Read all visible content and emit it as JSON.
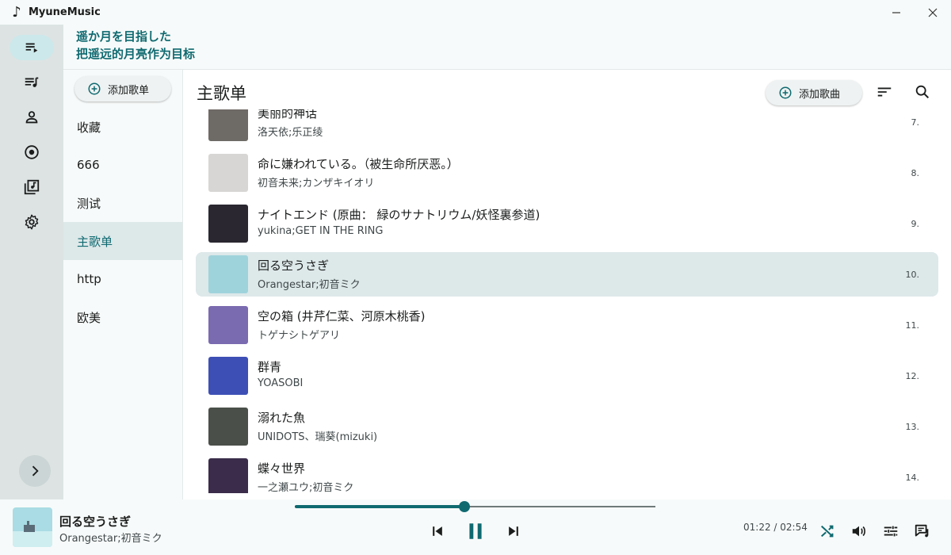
{
  "app": {
    "title": "MyuneMusic"
  },
  "lyrics": {
    "line1": "遥か月を目指した",
    "line2": "把遥远的月亮作为目标"
  },
  "nav_rail": [
    {
      "icon": "now-playing-icon",
      "active": true
    },
    {
      "icon": "playlist-icon",
      "active": false
    },
    {
      "icon": "artist-icon",
      "active": false
    },
    {
      "icon": "album-icon",
      "active": false
    },
    {
      "icon": "library-icon",
      "active": false
    },
    {
      "icon": "settings-icon",
      "active": false
    }
  ],
  "playlists": {
    "add_label": "添加歌单",
    "items": [
      "收藏",
      "666",
      "测试",
      "主歌单",
      "http",
      "欧美"
    ],
    "selected": "主歌单"
  },
  "main": {
    "title": "主歌单",
    "add_song_label": "添加歌曲"
  },
  "songs": [
    {
      "title": "美丽的神话",
      "artist": "洛天依;乐正绫",
      "index": "7.",
      "cover_color": "#6e6a66"
    },
    {
      "title": "命に嫌われている。（被生命所厌恶。）",
      "artist": "初音未来;カンザキイオリ",
      "index": "8.",
      "cover_color": "#d8d6d4"
    },
    {
      "title": "ナイトエンド (原曲： 緑のサナトリウム/妖怪裏参道)",
      "artist": "yukina;GET IN THE RING",
      "index": "9.",
      "cover_color": "#2a2730"
    },
    {
      "title": "回る空うさぎ",
      "artist": "Orangestar;初音ミク",
      "index": "10.",
      "cover_color": "#9fd3dc",
      "active": true
    },
    {
      "title": "空の箱 (井芹仁菜、河原木桃香)",
      "artist": "トゲナシトゲアリ",
      "index": "11.",
      "cover_color": "#7a6ab0"
    },
    {
      "title": "群青",
      "artist": "YOASOBI",
      "index": "12.",
      "cover_color": "#3d4fb5"
    },
    {
      "title": "溺れた魚",
      "artist": "UNIDOTS、瑞葵(mizuki)",
      "index": "13.",
      "cover_color": "#4a4f4a"
    },
    {
      "title": "蝶々世界",
      "artist": "一之瀬ユウ;初音ミク",
      "index": "14.",
      "cover_color": "#3a2c4a"
    }
  ],
  "player": {
    "title": "回る空うさぎ",
    "artist": "Orangestar;初音ミク",
    "time": "01:22 / 02:54",
    "progress": 0.47
  },
  "colors": {
    "accent": "#0f6a70",
    "rail_bg": "#dde3e3",
    "selected_bg": "#dde8e9"
  }
}
